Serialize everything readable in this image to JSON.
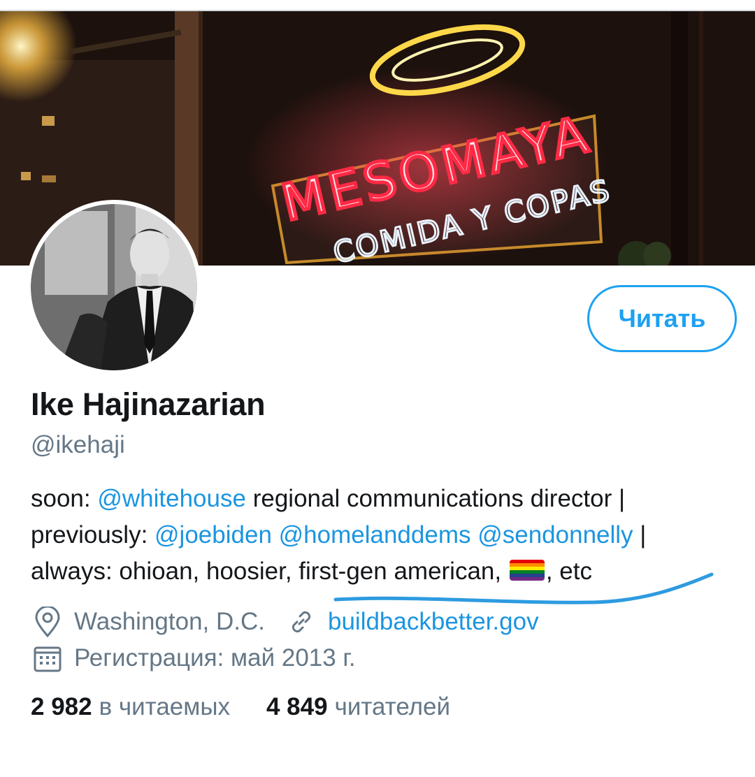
{
  "profile": {
    "name": "Ike Hajinazarian",
    "handle": "@ikehaji",
    "follow_label": "Читать",
    "banner_sign_main": "MESOMAYA",
    "banner_sign_sub": "COMIDA Y COPAS"
  },
  "bio": {
    "soon_label": "soon:",
    "mention_whitehouse": "@whitehouse",
    "text_after_whitehouse": "regional communications director |",
    "previously_label": "previously:",
    "mention_joebiden": "@joebiden",
    "mention_homelanddems": "@homelanddems",
    "mention_sendonnelly": "@sendonnelly",
    "pipe": "|",
    "always_text": "always: ohioan, hoosier, first-gen american,",
    "etc_text": ", etc"
  },
  "meta": {
    "location": "Washington, D.C.",
    "website": "buildbackbetter.gov",
    "joined": "Регистрация: май 2013 г."
  },
  "stats": {
    "following_count": "2 982",
    "following_label": "в читаемых",
    "followers_count": "4 849",
    "followers_label": "читателей"
  },
  "colors": {
    "accent": "#1da1f2",
    "link": "#1b95e0",
    "secondary_text": "#657786",
    "primary_text": "#14171a",
    "pen_underline": "#2e9be0"
  },
  "icons": {
    "location": "location-pin-icon",
    "link": "link-icon",
    "calendar": "calendar-icon",
    "flag": "rainbow-flag-icon"
  }
}
